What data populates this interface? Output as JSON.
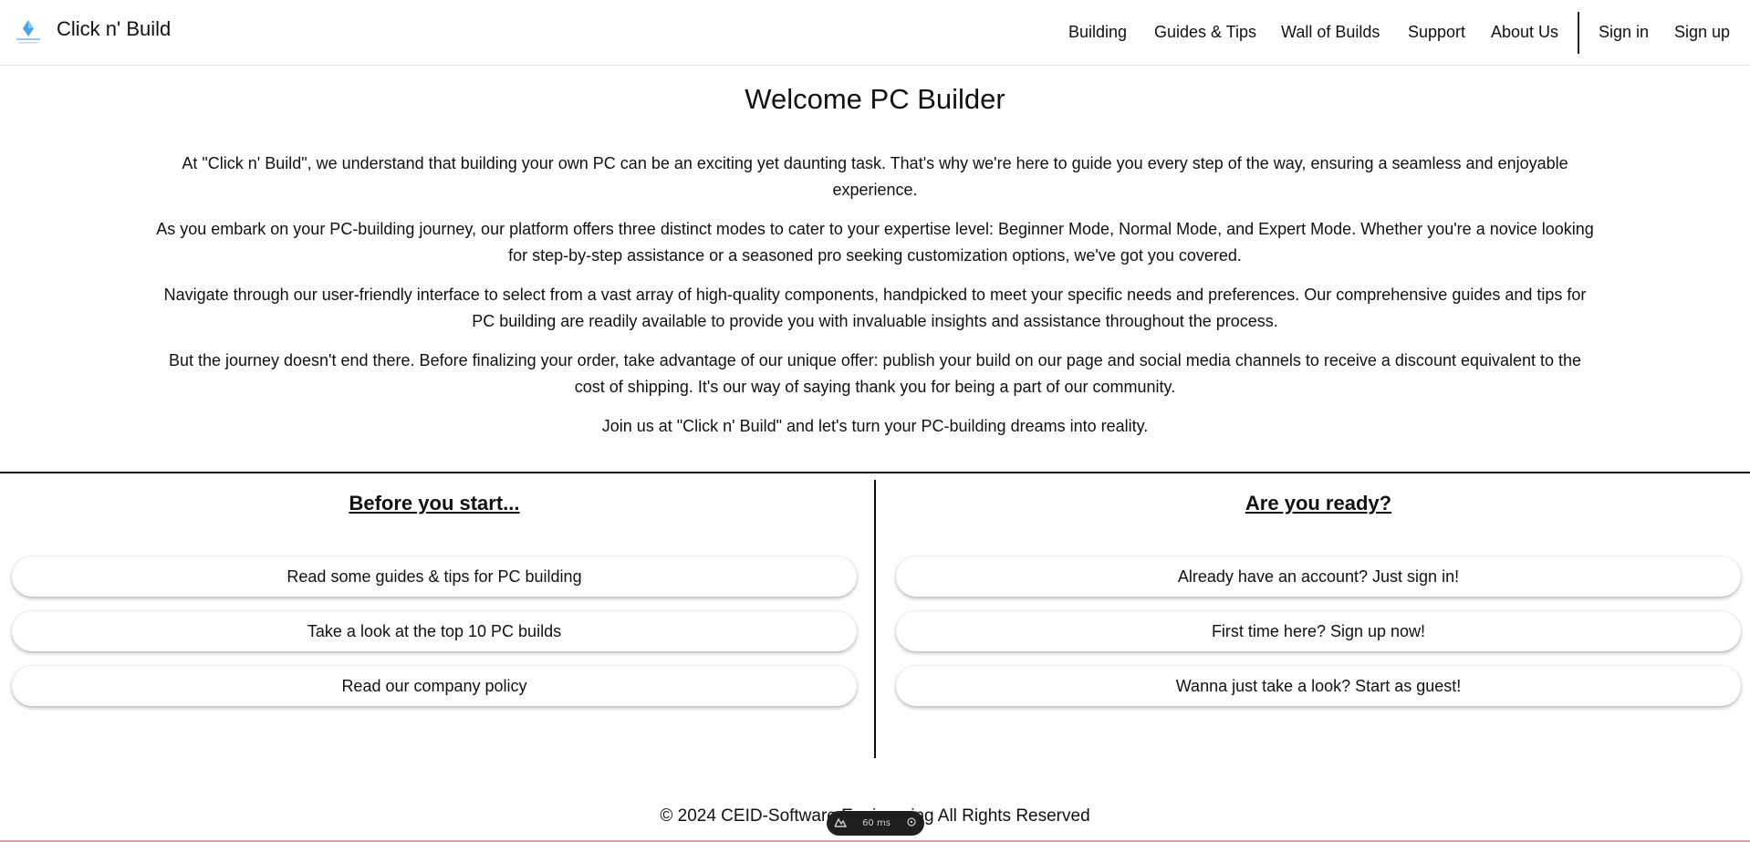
{
  "header": {
    "brand": "Click n' Build",
    "logo_icon": "diamond-logo-icon",
    "nav": [
      {
        "label": "Building"
      },
      {
        "label": "Guides & Tips"
      },
      {
        "label": "Wall of Builds"
      },
      {
        "label": "Support"
      },
      {
        "label": "About Us"
      },
      {
        "label": "Sign in"
      },
      {
        "label": "Sign up"
      }
    ]
  },
  "main": {
    "title": "Welcome PC Builder",
    "paragraphs": [
      "At \"Click n' Build\", we understand that building your own PC can be an exciting yet daunting task. That's why we're here to guide you every step of the way, ensuring a seamless and enjoyable experience.",
      "As you embark on your PC-building journey, our platform offers three distinct modes to cater to your expertise level: Beginner Mode, Normal Mode, and Expert Mode. Whether you're a novice looking for step-by-step assistance or a seasoned pro seeking customization options, we've got you covered.",
      "Navigate through our user-friendly interface to select from a vast array of high-quality components, handpicked to meet your specific needs and preferences. Our comprehensive guides and tips for PC building are readily available to provide you with invaluable insights and assistance throughout the process.",
      "But the journey doesn't end there. Before finalizing your order, take advantage of our unique offer: publish your build on our page and social media channels to receive a discount equivalent to the cost of shipping. It's our way of saying thank you for being a part of our community.",
      "Join us at \"Click n' Build\" and let's turn your PC-building dreams into reality."
    ]
  },
  "left": {
    "heading": "Before you start...",
    "buttons": [
      "Read some guides & tips for PC building",
      "Take a look at the top 10 PC builds",
      "Read our company policy"
    ]
  },
  "right": {
    "heading": "Are you ready?",
    "buttons": [
      "Already have an account? Just sign in!",
      "First time here? Sign up now!",
      "Wanna just take a look? Start as guest!"
    ]
  },
  "footer": {
    "text": "© 2024 CEID-Software Engineering All Rights Reserved"
  },
  "perf_widget": {
    "value": "60",
    "unit": "ms",
    "left_icon": "mountain-icon",
    "right_icon": "crosshair-icon"
  },
  "colors": {
    "text": "#111111",
    "logo_accent": "#4aa3e8",
    "widget_bg": "#1f1f1f"
  }
}
